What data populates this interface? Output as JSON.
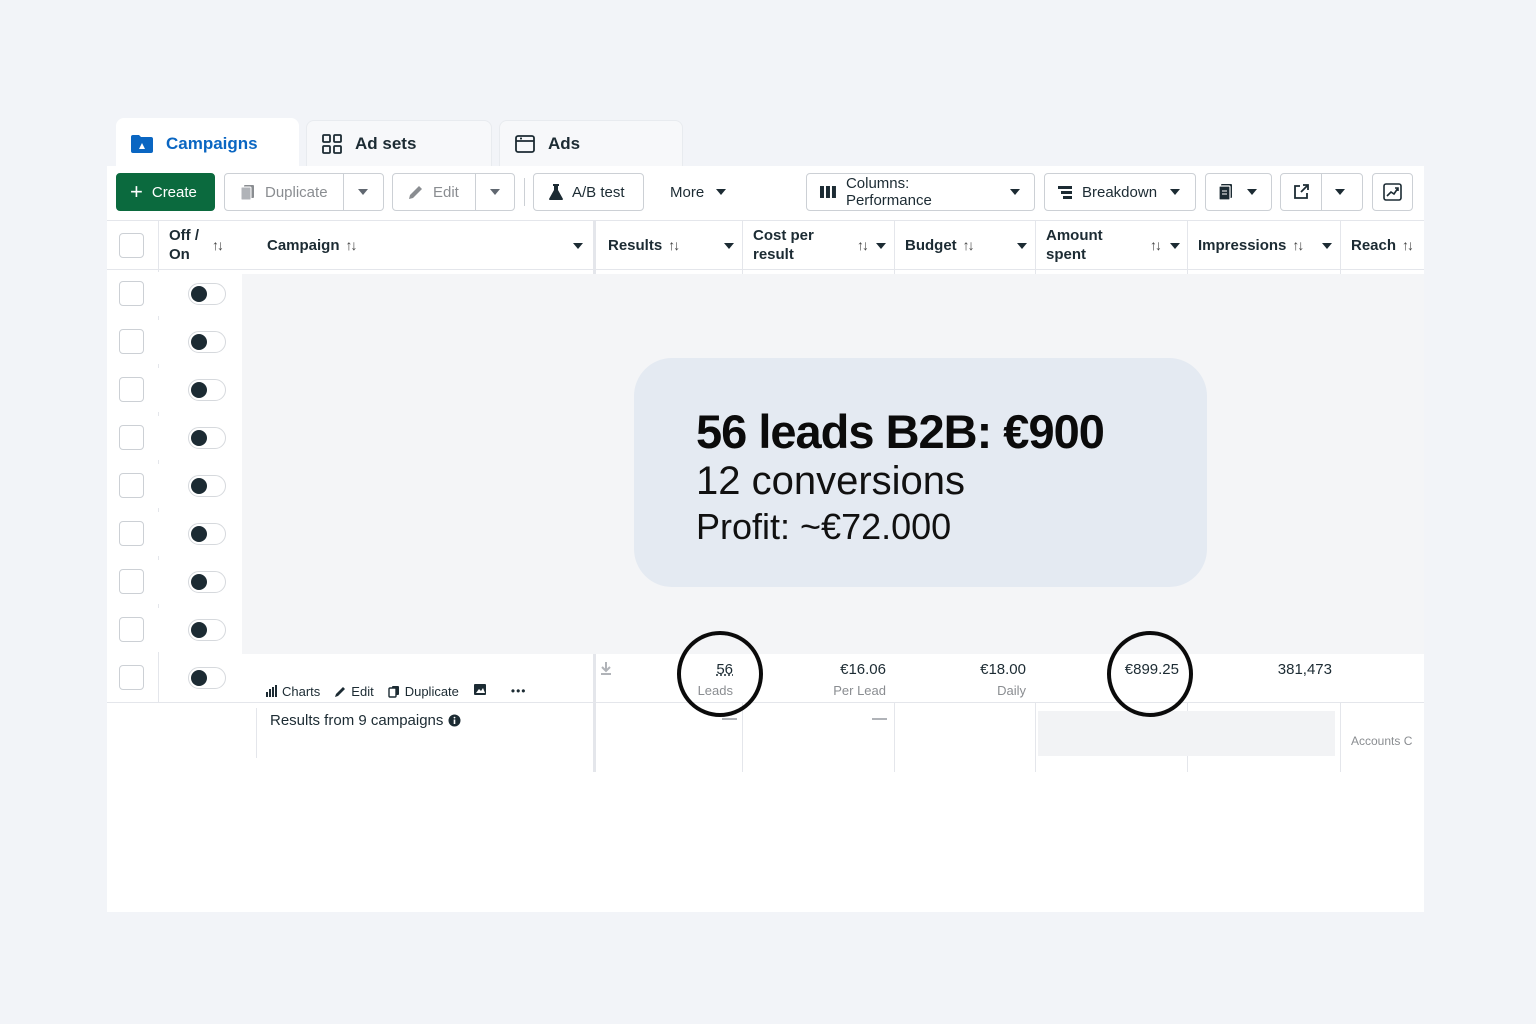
{
  "tabs": [
    {
      "label": "Campaigns",
      "icon": "folder-icon"
    },
    {
      "label": "Ad sets",
      "icon": "grid-icon"
    },
    {
      "label": "Ads",
      "icon": "ad-window-icon"
    }
  ],
  "toolbar": {
    "create": "Create",
    "duplicate": "Duplicate",
    "edit": "Edit",
    "ab_test": "A/B test",
    "more": "More",
    "columns": "Columns: Performance",
    "breakdown": "Breakdown"
  },
  "columns": {
    "off_on_1": "Off /",
    "off_on_2": "On",
    "campaign": "Campaign",
    "results": "Results",
    "cost_1": "Cost per",
    "cost_2": "result",
    "budget": "Budget",
    "amount_1": "Amount",
    "amount_2": "spent",
    "impressions": "Impressions",
    "reach": "Reach"
  },
  "sort_glyph": "↑↓",
  "row_count": 9,
  "row": {
    "actions": {
      "charts": "Charts",
      "edit": "Edit",
      "duplicate": "Duplicate",
      "more": "•••"
    },
    "results_value": "56",
    "results_unit": "Leads",
    "cost_value": "€16.06",
    "cost_unit": "Per Lead",
    "budget_value": "€18.00",
    "budget_unit": "Daily",
    "amount_value": "€899.25",
    "impressions_value": "381,473"
  },
  "summary": {
    "label": "Results from 9 campaigns",
    "results_dash": "—",
    "cost_dash": "—",
    "reach_note": "Accounts C"
  },
  "callout": {
    "line1": "56 leads B2B: €900",
    "line2": "12 conversions",
    "line3": "Profit: ~€72.000"
  },
  "colors": {
    "accent": "#0a66c2",
    "create_bg": "#0b6a3e",
    "callout_bg": "#e4eaf2"
  }
}
